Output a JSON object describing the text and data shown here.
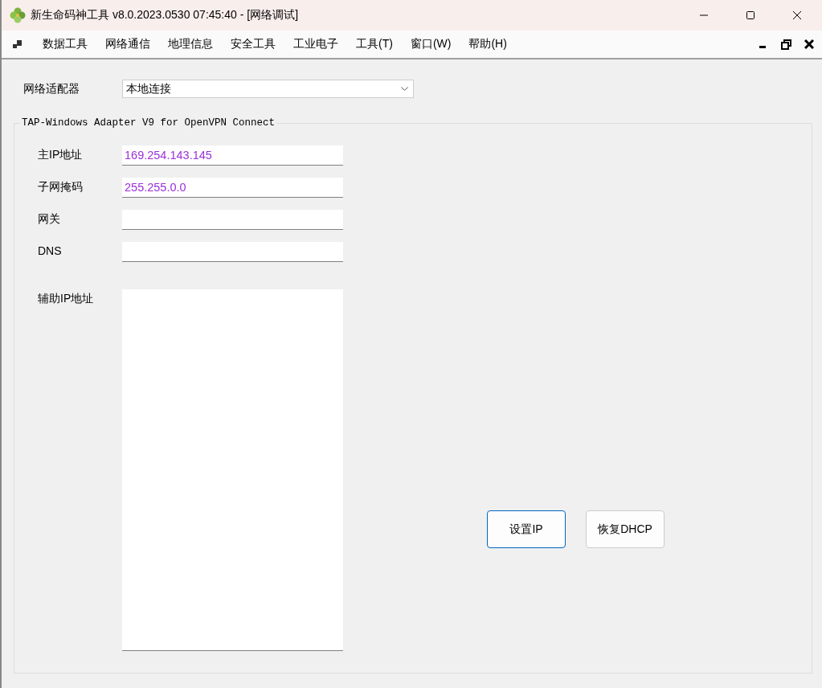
{
  "window": {
    "title": "新生命码神工具 v8.0.2023.0530 07:45:40 - [网络调试]"
  },
  "menu": {
    "items": [
      {
        "label": "数据工具"
      },
      {
        "label": "网络通信"
      },
      {
        "label": "地理信息"
      },
      {
        "label": "安全工具"
      },
      {
        "label": "工业电子"
      },
      {
        "label": "工具(T)"
      },
      {
        "label": "窗口(W)"
      },
      {
        "label": "帮助(H)"
      }
    ]
  },
  "adapter": {
    "label": "网络适配器",
    "value": "本地连接"
  },
  "group": {
    "title": "TAP-Windows Adapter V9 for OpenVPN Connect",
    "fields": [
      {
        "label": "主IP地址",
        "value": "169.254.143.145"
      },
      {
        "label": "子网掩码",
        "value": "255.255.0.0"
      },
      {
        "label": "网关"
      },
      {
        "label": "DNS"
      }
    ],
    "secondary": {
      "label": "辅助IP地址"
    },
    "buttons": [
      {
        "label": "设置IP",
        "focused": true
      },
      {
        "label": "恢复DHCP",
        "focused": false
      }
    ]
  }
}
